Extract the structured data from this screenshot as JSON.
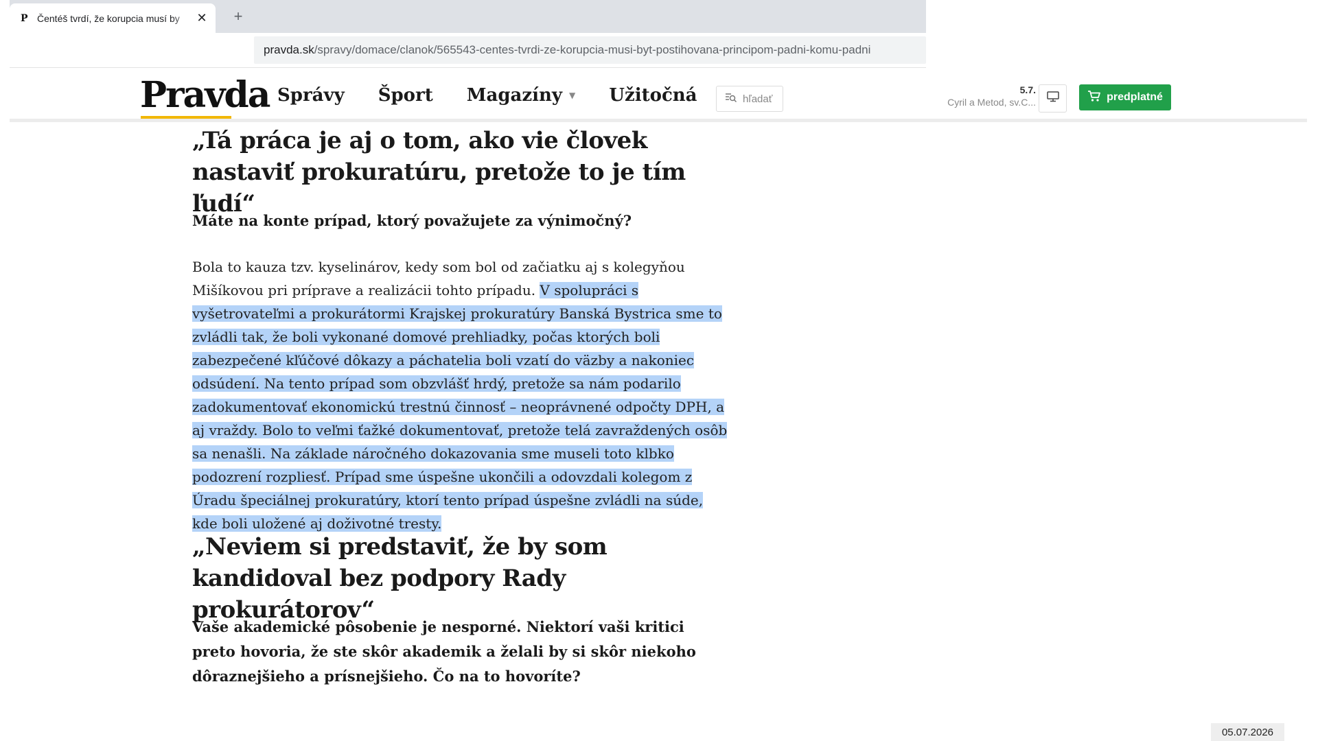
{
  "browser": {
    "tab_title": "Čentéš tvrdí, že korupcia musí by",
    "tab_favicon": "P",
    "tab_close": "✕",
    "new_tab": "+",
    "url_host": "pravda.sk",
    "url_path": "/spravy/domace/clanok/565543-centes-tvrdi-ze-korupcia-musi-byt-postihovana-principom-padni-komu-padni"
  },
  "header": {
    "logo": "Pravda",
    "nav": [
      {
        "label": "Správy"
      },
      {
        "label": "Šport"
      },
      {
        "label": "Magazíny",
        "has_dropdown": true
      },
      {
        "label": "Užitočná"
      }
    ],
    "search_placeholder": "hľadať",
    "date": "5.7.",
    "name_days": "Cyril a Metod, sv.C...",
    "subscribe_label": "predplatné",
    "accent_color": "#f2b705",
    "subscribe_color": "#21a04a"
  },
  "article": {
    "subhead_1": "„Tá práca je aj o tom, ako vie človek nastaviť prokuratúru, pretože to je tím ľudí“",
    "question_1": "Máte na konte prípad, ktorý považujete za výnimočný?",
    "answer_1_plain": "Bola to kauza tzv. kyselinárov, kedy som bol od začiatku aj s kolegyňou Mišíkovou pri príprave a realizácii tohto prípadu. ",
    "answer_1_selected": "V spolupráci s vyšetrovateľmi a prokurátormi Krajskej prokuratúry Banská Bystrica sme to zvládli tak, že boli vykonané domové prehliadky, počas ktorých boli zabezpečené kľúčové dôkazy a páchatelia boli vzatí do väzby a nakoniec odsúdení. Na tento prípad som obzvlášť hrdý, pretože sa nám podarilo zadokumentovať ekonomickú trestnú činnosť – neoprávnené odpočty DPH, a aj vraždy. Bolo to veľmi ťažké dokumentovať, pretože telá zavraždených osôb sa nenašli. Na základe náročného dokazovania sme museli toto klbko podozrení rozpliesť. Prípad sme úspešne ukončili a odovzdali kolegom z Úradu špeciálnej prokuratúry, ktorí tento prípad úspešne zvládli na súde, kde boli uložené aj doživotné tresty.",
    "subhead_2": "„Neviem si predstaviť, že by som kandidoval bez podpory Rady prokurátorov“",
    "question_2": "Vaše akademické pôsobenie je nesporné. Niektorí vaši kritici preto hovoria, že ste skôr akademik a želali by si skôr niekoho dôraznejšieho a prísnejšieho. Čo na to hovoríte?",
    "selection_color": "#b4d3f8"
  },
  "footer": {
    "date_stamp": "05.07.2026"
  }
}
